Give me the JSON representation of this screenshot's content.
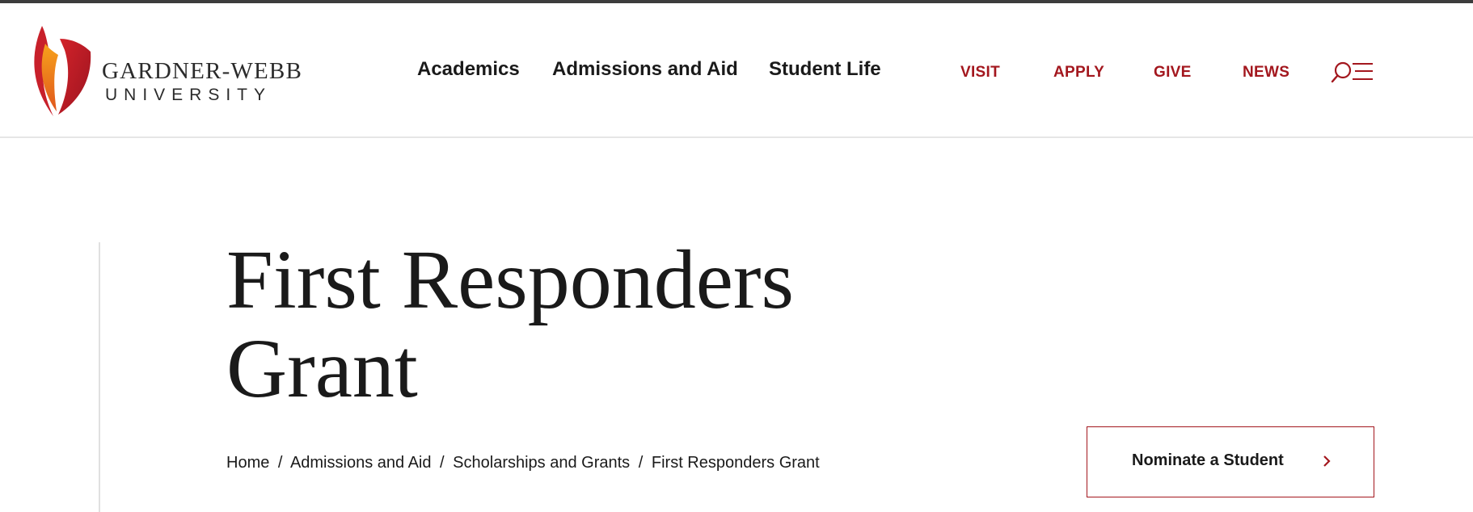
{
  "site": {
    "logo_name": "GARDNER-WEBB",
    "logo_sub": "UNIVERSITY"
  },
  "nav": {
    "main": [
      "Academics",
      "Admissions and Aid",
      "Student Life"
    ],
    "utility": [
      "VISIT",
      "APPLY",
      "GIVE",
      "NEWS"
    ]
  },
  "page": {
    "title_line1": "First Responders",
    "title_line2": "Grant"
  },
  "breadcrumb": {
    "items": [
      "Home",
      "Admissions and Aid",
      "Scholarships and Grants",
      "First Responders Grant"
    ],
    "separator": "/"
  },
  "cta": {
    "label": "Nominate a Student"
  },
  "colors": {
    "accent": "#a3171e",
    "text": "#1a1a1a",
    "flame_red": "#c8202a",
    "flame_orange": "#f07a22"
  },
  "icons": {
    "search_menu": "search-menu-icon",
    "cta_arrow": "chevron-right-icon"
  }
}
